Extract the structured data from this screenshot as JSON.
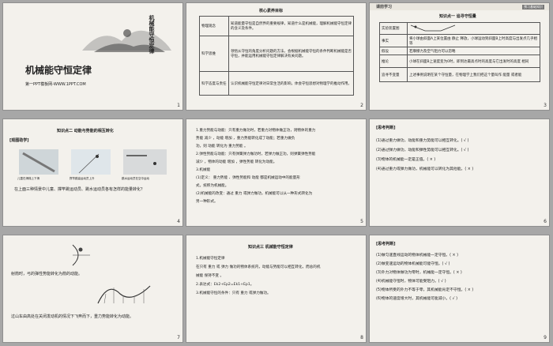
{
  "slides": [
    {
      "id": 1,
      "number": "1",
      "title": "机械能守恒定律",
      "vertical": "机械能守恒定律",
      "caption": "第一PPT模板网-WWW.1PPT.COM"
    },
    {
      "id": 2,
      "number": "2",
      "heading": "核心素养目标",
      "rows": [
        {
          "k": "物理观念",
          "v": "知道能量守恒是自然界的重要规律，知道什么是机械能，理解机械能守恒定律的含义及条件。"
        },
        {
          "k": "科学思维",
          "v": "领悟从守恒的角度分析问题的方法，会根据机械能守恒的条件判断机械能是否守恒，并能运用机械能守恒定律解决有关问题。"
        },
        {
          "k": "科学态度与责任",
          "v": "认识机械能守恒定律对日常生活的影响，体会守恒思想对物理学的推动作用。"
        }
      ]
    },
    {
      "id": 3,
      "number": "3",
      "tab": "课前学习",
      "badge": "预习基础知识",
      "sub": "知识点一  追寻守恒量",
      "rows": [
        {
          "k": "实验装置图",
          "v": ""
        },
        {
          "k": "事实",
          "v": "将小球由斜面A上某位置由 静止 释放，小球运动到斜面B上时高度与出发点几乎相等"
        },
        {
          "k": "假设",
          "v": "若摩擦力及空气阻力可以忽略"
        },
        {
          "k": "推论",
          "v": "小球在斜面B上速度变为0时，即到达最高点时的高度与它出发时的高度 相同"
        },
        {
          "k": "追寻不变量",
          "v": "上述事例说明在某个守恒量，在物理学上我们把这个量叫作 能量 或者能"
        }
      ]
    },
    {
      "id": 4,
      "number": "4",
      "sub": "知识点二  动能与势能的相互转化",
      "label": "[观图助学]",
      "captions": [
        "儿童在滑梯上下滑",
        "撑竿跳高运动员上升",
        "跳水运动员在空中运动"
      ],
      "question": "在上面三种情景中儿童、撑竿跳运动员、跳水运动员各有怎样的能量转化？"
    },
    {
      "id": 5,
      "number": "5",
      "lines": [
        "1.重力势能与动能：只有重力做功时，若重力对物体做正功，则物体的重力",
        "势能 减少 ，动能 增加 ，重力势能转化成了动能；若重力做负",
        "功，则 动能 转化为 重力势能 。",
        "2.弹性势能与动能：只有弹簧弹力做功时，若弹力做正功，则弹簧弹性势能",
        " 减少 ，物体的动能 增加 ，弹性势能 转化为动能。",
        "3.机械能",
        "(1)定义： 重力势能 、弹性势能和 动能 都是机械运动中的能量形",
        "式，统称为机械能。",
        "(2)机械能的改变：通过 重力 或弹力做功，机械能可以从一种形式转化为",
        "另一种形式。"
      ]
    },
    {
      "id": 6,
      "number": "6",
      "label": "[思考判断]",
      "items": [
        "(1)通过重力做功，动能和重力势能可以相互转化。( √ )",
        "(2)通过弹力做功，动能和弹性势能可以相互转化。( √ )",
        "(3)物体的机械能一定是正值。( × )",
        "(4)通过重力或弹力做功，机械能可以转化为其他能。( × )"
      ]
    },
    {
      "id": 7,
      "number": "7",
      "cap1": "射箭时，弓的弹性势能转化为箭的动能。",
      "cap2": "过山车由高处在关闭发动机的情况下飞奔而下，重力势能转化为动能。"
    },
    {
      "id": 8,
      "number": "8",
      "sub": "知识点三  机械能守恒定律",
      "lines": [
        "1.机械能守恒定律",
        "在只有 重力 或 弹力 做功的物体系统内，动能与势能可以相互转化，而总的机",
        "械能 保持不变 。",
        "2.表达式：Ek2+Ep2=Ek1+Ep1。",
        "3.机械能守恒的条件：只有 重力 或弹力做功。"
      ]
    },
    {
      "id": 9,
      "number": "9",
      "label": "[思考判断]",
      "items": [
        "(1)做匀速直线运动的物体机械能一定守恒。( × )",
        "(2)做变速运动的物体机械能可能守恒。( √ )",
        "(3)外力对物体做功为零时，机械能一定守恒。( × )",
        "(4)机械能守恒时，物体可能受阻力。( √ )",
        "(5)物体所受的外力不等于零，其机械能肯定不守恒。( × )",
        "(6)物体的速度增大时，其机械能可能减小。( √ )"
      ]
    }
  ]
}
